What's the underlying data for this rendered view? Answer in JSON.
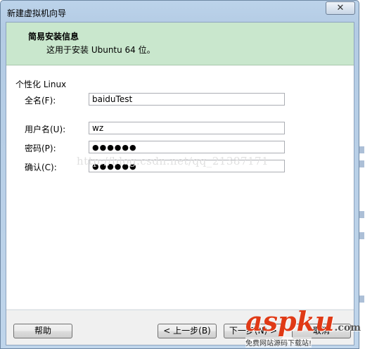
{
  "window": {
    "title": "新建虚拟机向导",
    "close_symbol": "✕"
  },
  "header": {
    "title": "简易安装信息",
    "subtitle": "这用于安装 Ubuntu 64 位。"
  },
  "form": {
    "group_label": "个性化 Linux",
    "full_name": {
      "label": "全名(F):",
      "value": "baiduTest"
    },
    "username": {
      "label": "用户名(U):",
      "value": "wz"
    },
    "password": {
      "label": "密码(P):",
      "value": "●●●●●●"
    },
    "confirm": {
      "label": "确认(C):",
      "value": "●●●●●●"
    }
  },
  "watermark": "http://blog.csdn.net/qq_21387171",
  "buttons": {
    "help": "帮助",
    "back": "< 上一步(B)",
    "next": "下一步(N) >",
    "cancel": "取消"
  },
  "brand": {
    "name": "aspku",
    "tld": ".com",
    "tagline": "免费网站源码下载站!"
  }
}
